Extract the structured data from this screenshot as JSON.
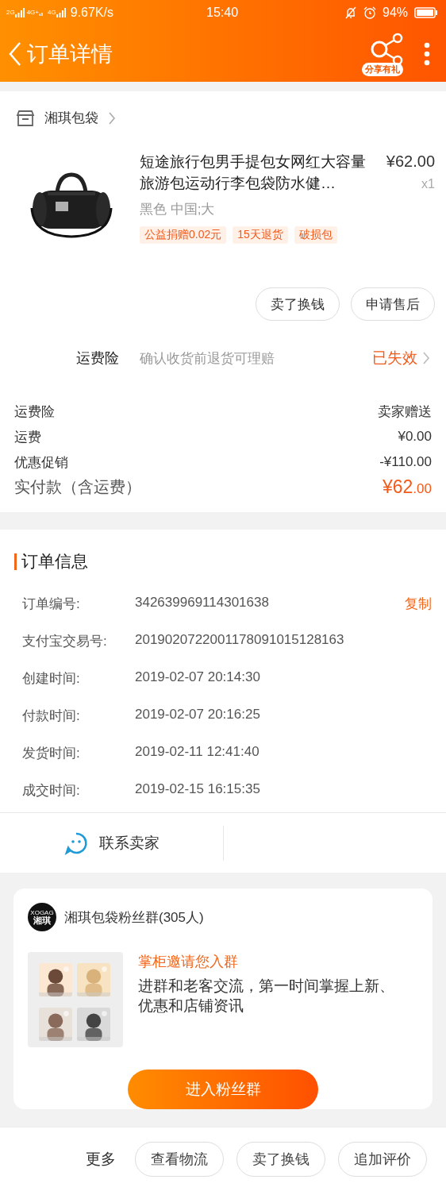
{
  "status_bar": {
    "network_labels": [
      "2G",
      "4G+",
      "4G"
    ],
    "net_speed": "9.67K/s",
    "time": "15:40",
    "battery": "94%"
  },
  "header": {
    "title": "订单详情",
    "share_badge": "分享有礼"
  },
  "shop": {
    "name": "湘琪包袋"
  },
  "product": {
    "kind": "picture",
    "title": "短途旅行包男手提包女网红大容量旅游包运动行李包袋防水健…",
    "price": "¥62.00",
    "quantity": "x1",
    "variant": "黑色 中国;大",
    "tags": [
      "公益捐赠0.02元",
      "15天退货",
      "破损包"
    ]
  },
  "item_actions": [
    "卖了换钱",
    "申请售后"
  ],
  "insurance": {
    "label": "运费险",
    "description": "确认收货前退货可理赔",
    "status": "已失效"
  },
  "fees": [
    {
      "label": "运费险",
      "value": "卖家赠送"
    },
    {
      "label": "运费",
      "value": "¥0.00"
    },
    {
      "label": "优惠促销",
      "value": "-¥110.00"
    }
  ],
  "total": {
    "label": "实付款（含运费）",
    "value": "¥62.00"
  },
  "order_info": {
    "title": "订单信息",
    "rows": [
      {
        "label": "订单编号:",
        "value": "342639969114301638",
        "action": "复制"
      },
      {
        "label": "支付宝交易号:",
        "value": "2019020722001178091015128163"
      },
      {
        "label": "创建时间:",
        "value": "2019-02-07 20:14:30"
      },
      {
        "label": "付款时间:",
        "value": "2019-02-07 20:16:25"
      },
      {
        "label": "发货时间:",
        "value": "2019-02-11 12:41:40"
      },
      {
        "label": "成交时间:",
        "value": "2019-02-15 16:15:35"
      }
    ]
  },
  "contact": {
    "label": "联系卖家"
  },
  "fan_group": {
    "avatar_small_text": "XOGAG",
    "avatar_text": "湘琪",
    "name": "湘琪包袋粉丝群(305人)",
    "invite_title": "掌柜邀请您入群",
    "invite_text": "进群和老客交流，第一时间掌握上新、优惠和店铺资讯",
    "join_button": "进入粉丝群"
  },
  "bottom_bar": {
    "more": "更多",
    "buttons": [
      "查看物流",
      "卖了换钱",
      "追加评价"
    ]
  }
}
